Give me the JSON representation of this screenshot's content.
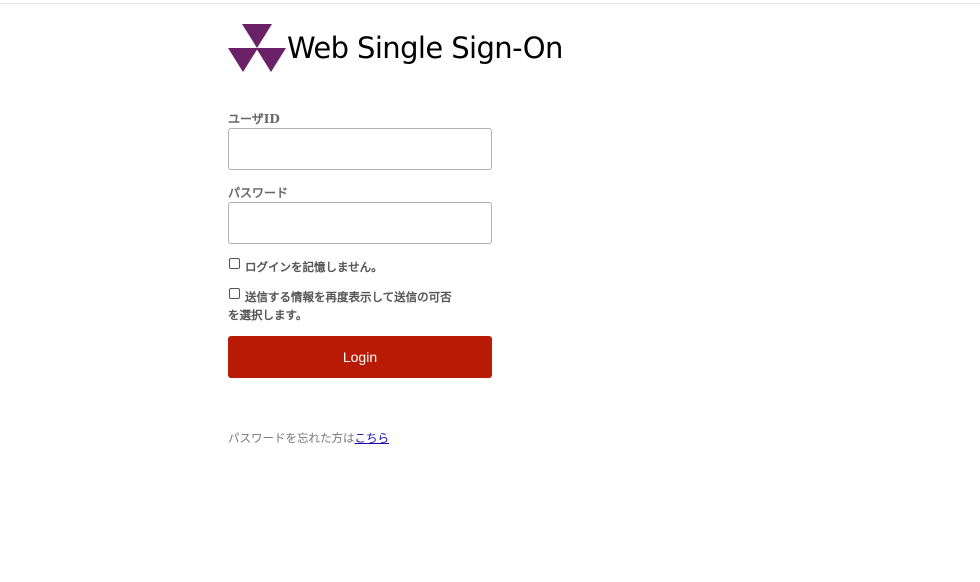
{
  "brand": {
    "title": "Web Single Sign-On",
    "logo_icon": "triangle-logo-icon",
    "logo_color": "#6b2168"
  },
  "form": {
    "user_id_label": "ユーザID",
    "user_id_value": "",
    "password_label": "パスワード",
    "password_value": "",
    "remember_label": "ログインを記憶しません。",
    "consent_label_line1": "送信する情報を再度表示して送信の可否",
    "consent_label_line2": "を選択します。",
    "login_label": "Login",
    "login_color": "#b81a05"
  },
  "footer": {
    "forgot_text": "パスワードを忘れた方は",
    "forgot_link": "こちら"
  }
}
